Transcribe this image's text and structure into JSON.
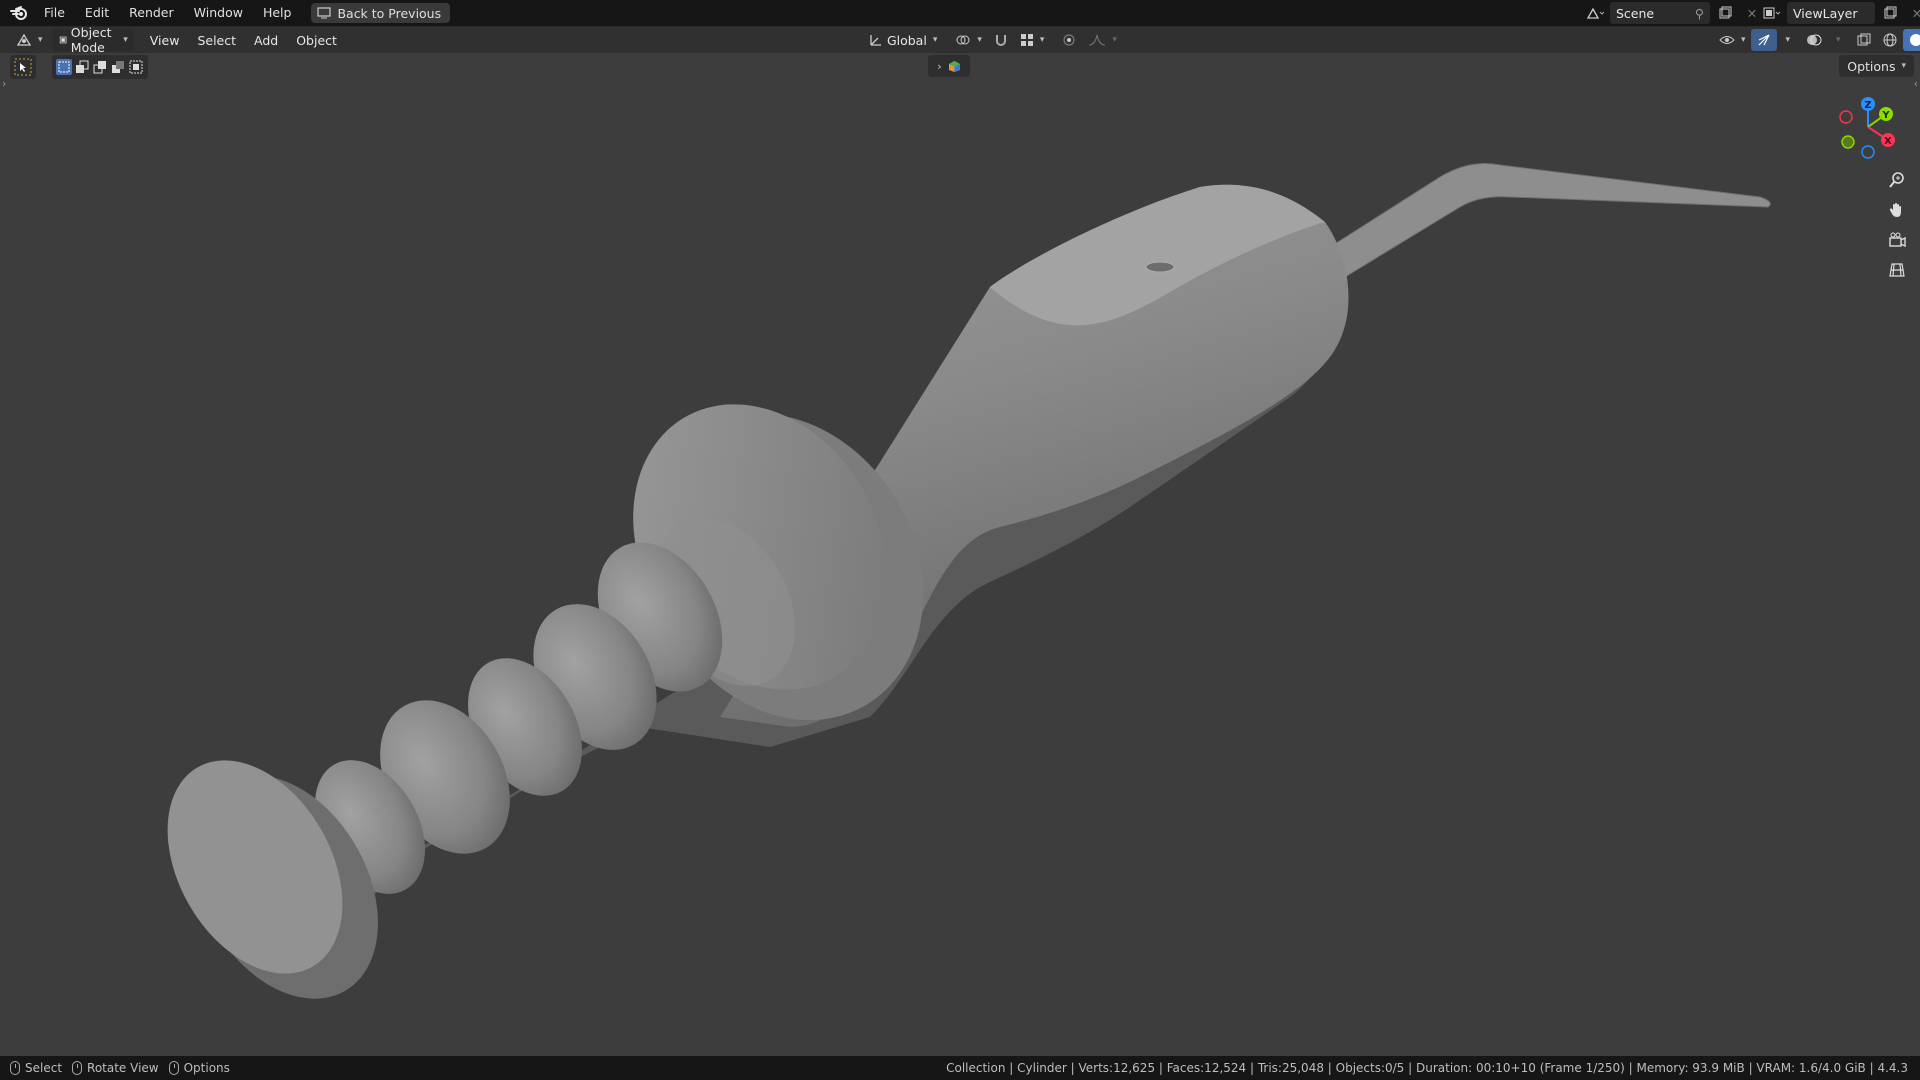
{
  "menu": {
    "items": [
      "File",
      "Edit",
      "Render",
      "Window",
      "Help"
    ],
    "back_label": "Back to Previous"
  },
  "scene": {
    "name": "Scene"
  },
  "view_layer": {
    "name": "ViewLayer"
  },
  "header": {
    "mode": "Object Mode",
    "menus": [
      "View",
      "Select",
      "Add",
      "Object"
    ],
    "orientation": "Global"
  },
  "options_label": "Options",
  "gizmo": {
    "x": "X",
    "y": "Y",
    "z": "Z"
  },
  "status": {
    "left": [
      {
        "label": "Select"
      },
      {
        "label": "Rotate View"
      },
      {
        "label": "Options"
      }
    ],
    "stats": "Collection | Cylinder | Verts:12,625 | Faces:12,524 | Tris:25,048 | Objects:0/5 | Duration: 00:10+10 (Frame 1/250) | Memory: 93.9 MiB | VRAM: 1.6/4.0 GiB | 4.4.3"
  },
  "colors": {
    "viewport_bg": "#3d3d3d",
    "axis_x": "#ff3352",
    "axis_y": "#8bdc00",
    "axis_z": "#2890ff",
    "model": "#8a8a8a"
  }
}
